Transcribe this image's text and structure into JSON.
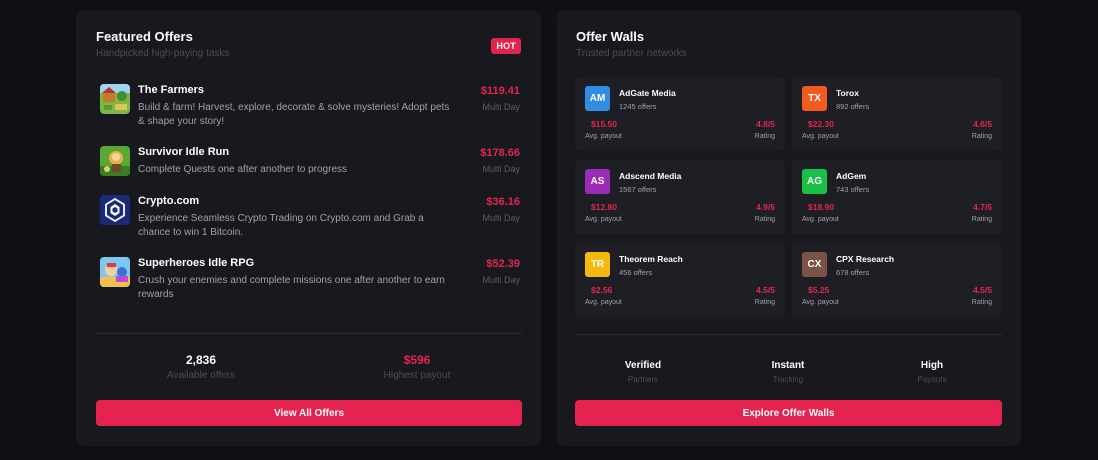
{
  "featured": {
    "title": "Featured Offers",
    "subtitle": "Handpicked high-paying tasks",
    "badge": "HOT",
    "offers": [
      {
        "name": "The Farmers",
        "desc": "Build & farm! Harvest, explore, decorate & solve mysteries! Adopt pets & shape your story!",
        "price": "$119.41",
        "duration": "Multi Day",
        "icon": "farmers-game-icon"
      },
      {
        "name": "Survivor Idle Run",
        "desc": "Complete Quests one after another to progress",
        "price": "$178.66",
        "duration": "Multi Day",
        "icon": "survivor-game-icon"
      },
      {
        "name": "Crypto.com",
        "desc": "Experience Seamless Crypto Trading on Crypto.com and Grab a chance to win 1 Bitcoin.",
        "price": "$36.16",
        "duration": "Multi Day",
        "icon": "crypto-com-icon"
      },
      {
        "name": "Superheroes Idle RPG",
        "desc": "Crush your enemies and complete missions one after another to earn rewards",
        "price": "$52.39",
        "duration": "Multi Day",
        "icon": "superheroes-game-icon"
      }
    ],
    "stats": [
      {
        "value": "2,836",
        "label": "Available offers"
      },
      {
        "value": "$596",
        "label": "Highest payout"
      }
    ],
    "cta": "View All Offers"
  },
  "walls": {
    "title": "Offer Walls",
    "subtitle": "Trusted partner networks",
    "payout_label": "Avg. payout",
    "rating_label": "Rating",
    "items": [
      {
        "abbr": "AM",
        "name": "AdGate Media",
        "offers": "1245 offers",
        "payout": "$15.50",
        "rating": "4.8/5",
        "color": "#2f8de4"
      },
      {
        "abbr": "TX",
        "name": "Torox",
        "offers": "892 offers",
        "payout": "$22.30",
        "rating": "4.6/5",
        "color": "#f25a1e"
      },
      {
        "abbr": "AS",
        "name": "Adscend Media",
        "offers": "1567 offers",
        "payout": "$12.80",
        "rating": "4.9/5",
        "color": "#9b2ab5"
      },
      {
        "abbr": "AG",
        "name": "AdGem",
        "offers": "743 offers",
        "payout": "$18.90",
        "rating": "4.7/5",
        "color": "#18c046"
      },
      {
        "abbr": "TR",
        "name": "Theorem Reach",
        "offers": "456 offers",
        "payout": "$2.56",
        "rating": "4.5/5",
        "color": "#f5b80c"
      },
      {
        "abbr": "CX",
        "name": "CPX Research",
        "offers": "678 offers",
        "payout": "$5.25",
        "rating": "4.5/5",
        "color": "#7a5345"
      }
    ],
    "features": [
      {
        "value": "Verified",
        "label": "Partners"
      },
      {
        "value": "Instant",
        "label": "Tracking"
      },
      {
        "value": "High",
        "label": "Payouts"
      }
    ],
    "cta": "Explore Offer Walls"
  },
  "colors": {
    "accent": "#e4244f",
    "card": "#18191e",
    "background": "#0f1014"
  }
}
